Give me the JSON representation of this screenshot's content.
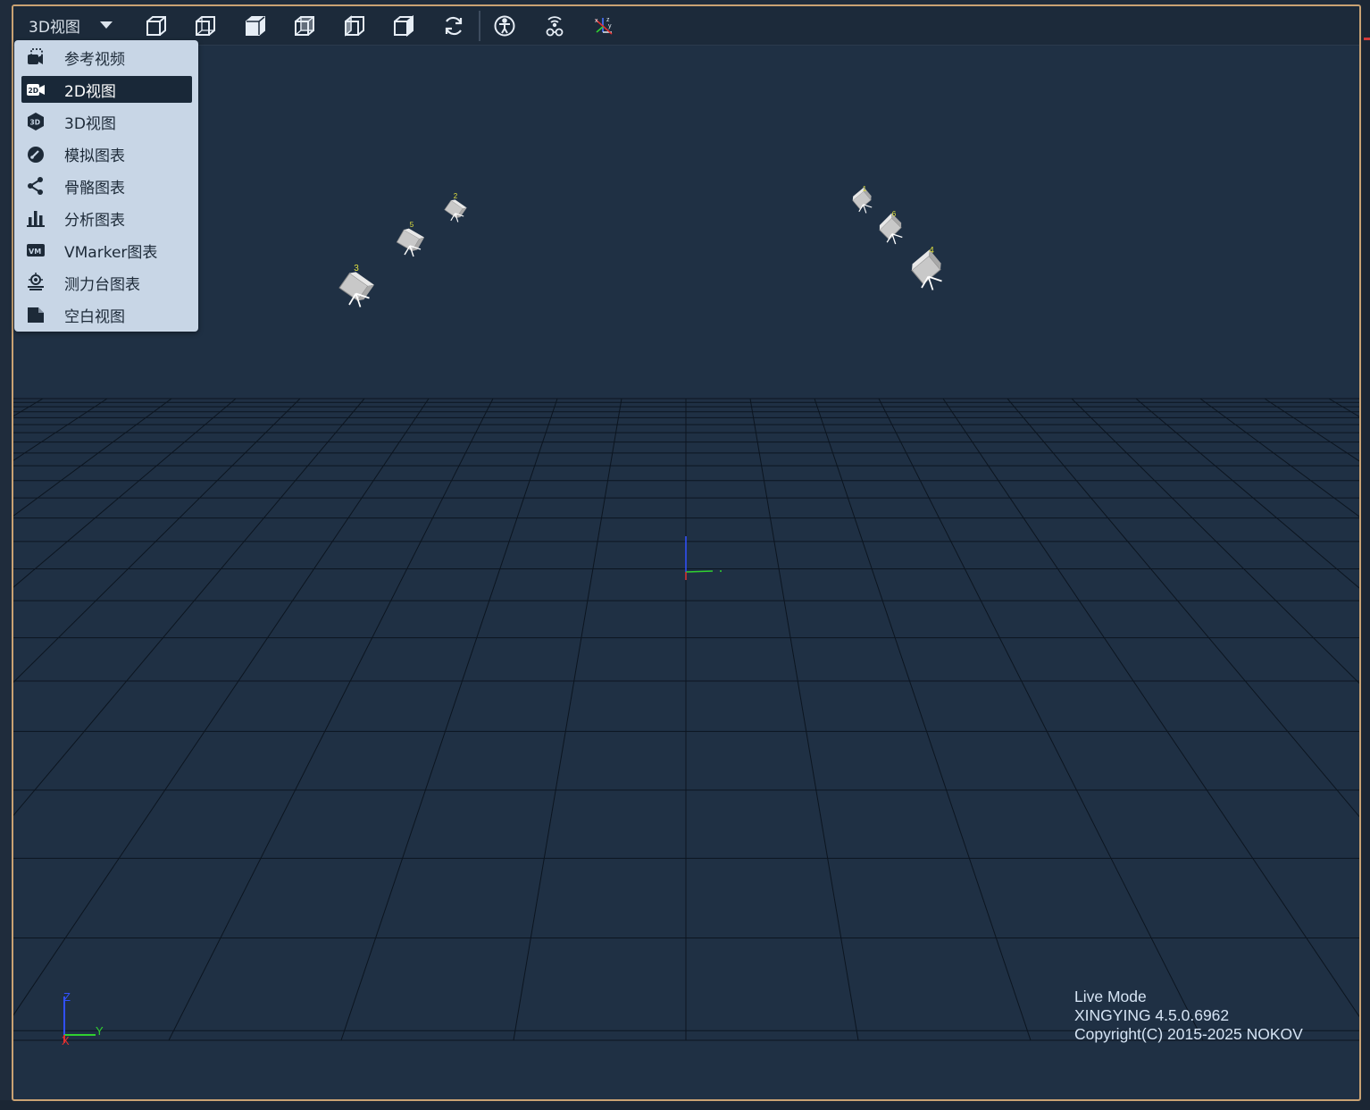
{
  "view_selector": {
    "label": "3D视图"
  },
  "toolbar": {
    "buttons": [
      {
        "name": "front-view-icon"
      },
      {
        "name": "back-view-icon"
      },
      {
        "name": "left-view-icon"
      },
      {
        "name": "right-view-icon"
      },
      {
        "name": "top-view-icon"
      },
      {
        "name": "bottom-view-icon"
      },
      {
        "name": "reset-view-icon"
      },
      {
        "name": "skeleton-icon"
      },
      {
        "name": "wireless-device-icon"
      },
      {
        "name": "axis-icon"
      }
    ]
  },
  "menu": {
    "items": [
      {
        "label": "参考视频",
        "icon": "reference-video-icon"
      },
      {
        "label": "2D视图",
        "icon": "2d-view-icon",
        "active": true
      },
      {
        "label": "3D视图",
        "icon": "3d-view-icon"
      },
      {
        "label": "模拟图表",
        "icon": "analog-chart-icon"
      },
      {
        "label": "骨骼图表",
        "icon": "skeleton-chart-icon"
      },
      {
        "label": "分析图表",
        "icon": "analysis-chart-icon"
      },
      {
        "label": "VMarker图表",
        "icon": "vmarker-chart-icon"
      },
      {
        "label": "测力台图表",
        "icon": "force-plate-chart-icon"
      },
      {
        "label": "空白视图",
        "icon": "blank-view-icon"
      }
    ]
  },
  "cameras": [
    {
      "id": "1"
    },
    {
      "id": "2"
    },
    {
      "id": "3"
    },
    {
      "id": "4"
    },
    {
      "id": "5"
    },
    {
      "id": "6"
    }
  ],
  "axis_labels": {
    "z": "Z",
    "y": "Y",
    "x": "X"
  },
  "info": {
    "mode": "Live Mode",
    "version": "XINGYING 4.5.0.6962",
    "copyright": "Copyright(C) 2015-2025 NOKOV"
  },
  "colors": {
    "background": "#1f3044",
    "toolbar": "#1c2a3a",
    "frame": "#c9a273",
    "menu": "#c8d6e6",
    "menu_active": "#192838",
    "camera_label": "#e0e040",
    "axis_x": "#e03030",
    "axis_y": "#30d030",
    "axis_z": "#3050ff"
  }
}
